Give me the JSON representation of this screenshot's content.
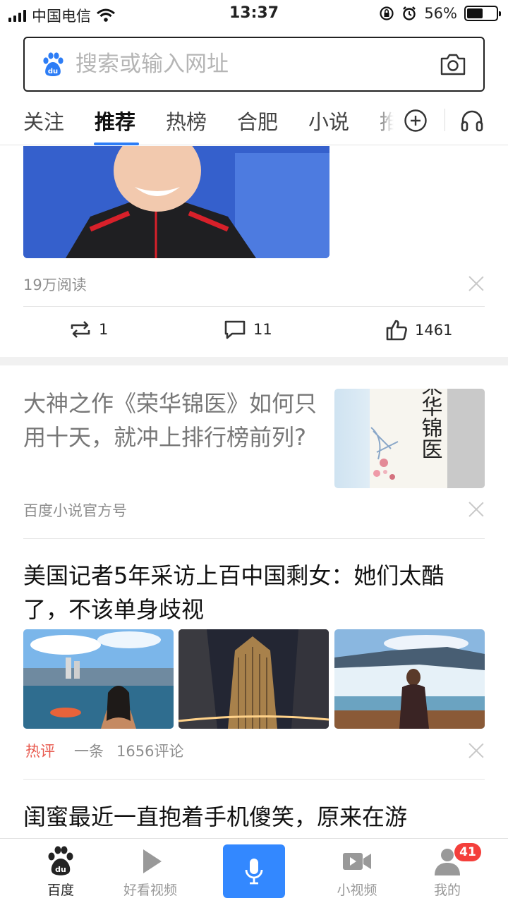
{
  "status_bar": {
    "carrier": "中国电信",
    "time": "13:37",
    "battery": "56%",
    "battery_level": 0.56
  },
  "search": {
    "placeholder": "搜索或输入网址"
  },
  "tabs": [
    {
      "label": "关注",
      "active": false
    },
    {
      "label": "推荐",
      "active": true
    },
    {
      "label": "热榜",
      "active": false
    },
    {
      "label": "合肥",
      "active": false
    },
    {
      "label": "小说",
      "active": false
    },
    {
      "label": "推",
      "active": false
    }
  ],
  "feed": {
    "item1": {
      "reads": "19万阅读",
      "repost_count": "1",
      "comment_count": "11",
      "like_count": "1461"
    },
    "item2": {
      "title": "大神之作《荣华锦医》如何只用十天，就冲上排行榜前列?",
      "source": "百度小说官方号",
      "thumb_text": "荣华锦医"
    },
    "item3": {
      "title": "美国记者5年采访上百中国剩女：她们太酷了，不该单身歧视",
      "tag": "热评",
      "source": "一条",
      "comments": "1656评论"
    },
    "item4": {
      "title": "闺蜜最近一直抱着手机傻笑，原来在游"
    }
  },
  "bottom_nav": [
    {
      "label": "百度",
      "icon": "baidu-paw-icon",
      "active": true
    },
    {
      "label": "好看视频",
      "icon": "play-icon",
      "active": false
    },
    {
      "label": "",
      "icon": "microphone-icon",
      "active": false
    },
    {
      "label": "小视频",
      "icon": "video-camera-icon",
      "active": false
    },
    {
      "label": "我的",
      "icon": "person-icon",
      "active": false
    }
  ],
  "profile_badge": "41",
  "colors": {
    "accent": "#2d7df6",
    "mic": "#3388ff",
    "hot": "#e85a4f",
    "badge": "#f43f3b"
  }
}
